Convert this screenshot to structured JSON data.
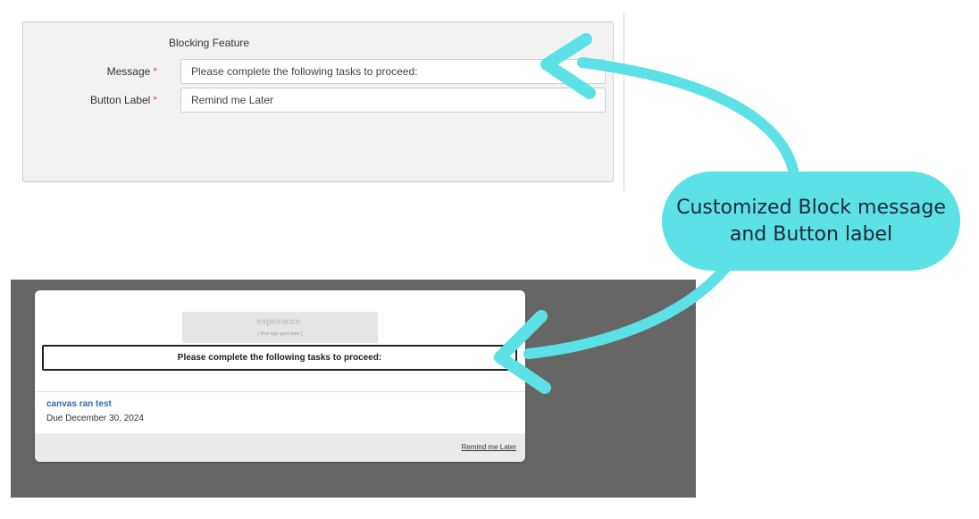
{
  "settings": {
    "section_title": "Blocking Feature",
    "message_label": "Message",
    "button_label_label": "Button Label",
    "required_marker": "*",
    "message_value": "Please complete the following tasks to proceed:",
    "button_label_value": "Remind me Later"
  },
  "preview": {
    "logo_text": "explorance.",
    "logo_subtext": "[ Your logo goes here ]",
    "block_message": "Please complete the following tasks to proceed:",
    "task_title": "canvas ran test",
    "task_due": "Due December 30, 2024",
    "remind_button": "Remind me Later"
  },
  "callout": {
    "line1": "Customized Block message",
    "line2": "and Button label"
  },
  "colors": {
    "accent": "#5ce1e6",
    "link": "#2f6fa7",
    "preview_background": "#666666"
  }
}
